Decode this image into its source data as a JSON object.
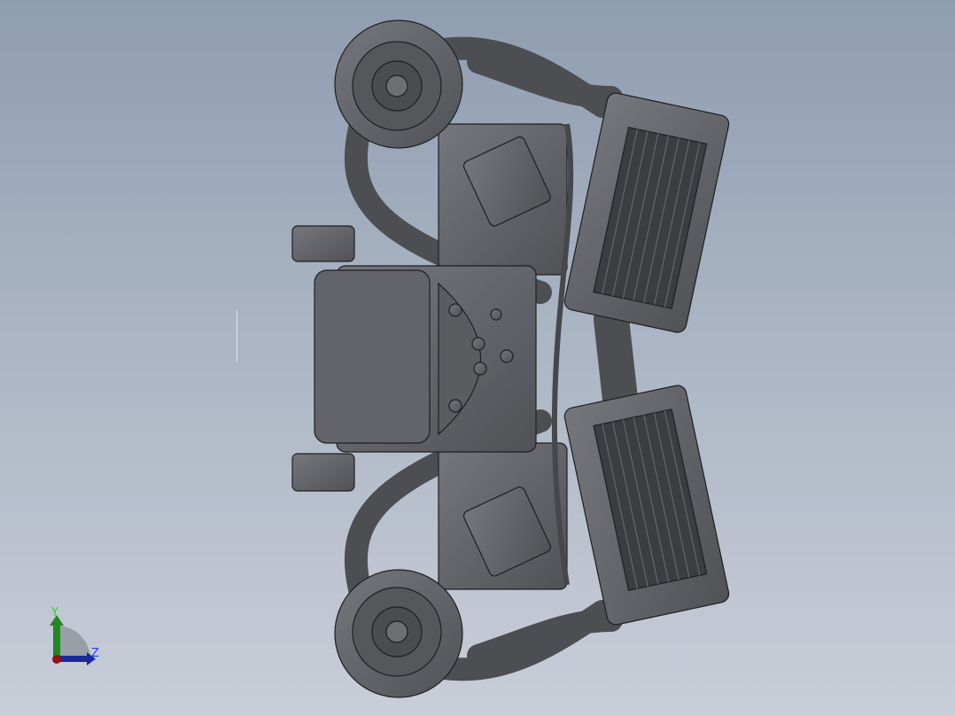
{
  "viewport": {
    "model": "engine-assembly",
    "colors": {
      "background_top": "#8f9db0",
      "background_bottom": "#c9ced8",
      "part": "#5f6166",
      "edge": "#1e1f22"
    }
  },
  "triad": {
    "y_label": "Y",
    "z_label": "Z",
    "colors": {
      "y": "#1f8a1f",
      "z": "#1a2a9a",
      "x": "#9a1010"
    }
  }
}
